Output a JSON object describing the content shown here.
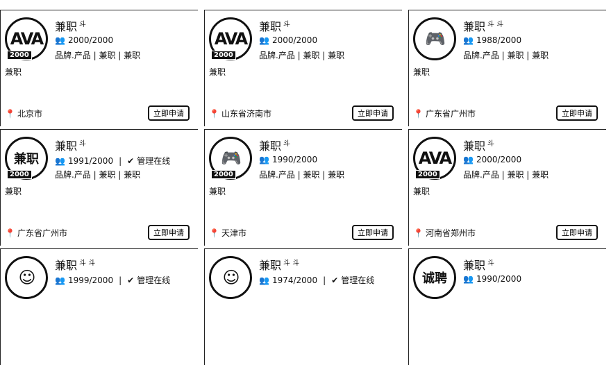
{
  "cards": [
    {
      "title": "兼职",
      "superscript": "斗",
      "logo_text": "AVA",
      "badge": "2000",
      "members": "2000/2000",
      "online": "",
      "tags": "品牌.产品 | 兼职 | 兼职",
      "desc": "兼职",
      "location": "北京市",
      "apply": "立即申请"
    },
    {
      "title": "兼职",
      "superscript": "斗",
      "logo_text": "AVA",
      "badge": "2000",
      "members": "2000/2000",
      "online": "",
      "tags": "品牌.产品 | 兼职 | 兼职",
      "desc": "兼职",
      "location": "山东省济南市",
      "apply": "立即申请"
    },
    {
      "title": "兼职",
      "superscript": "斗 斗",
      "logo_text": "🎮",
      "badge": "",
      "members": "1988/2000",
      "online": "",
      "tags": "品牌.产品 | 兼职 | 兼职",
      "desc": "兼职",
      "location": "广东省广州市",
      "apply": "立即申请"
    },
    {
      "title": "兼职",
      "superscript": "斗",
      "logo_text": "兼职",
      "badge": "2000",
      "members": "1991/2000",
      "online": "管理在线",
      "tags": "品牌.产品 | 兼职 | 兼职",
      "desc": "兼职",
      "location": "广东省广州市",
      "apply": "立即申请"
    },
    {
      "title": "兼职",
      "superscript": "斗",
      "logo_text": "🎮",
      "badge": "2000",
      "members": "1990/2000",
      "online": "",
      "tags": "品牌.产品 | 兼职 | 兼职",
      "desc": "兼职",
      "location": "天津市",
      "apply": "立即申请"
    },
    {
      "title": "兼职",
      "superscript": "斗",
      "logo_text": "AVA",
      "badge": "2000",
      "members": "2000/2000",
      "online": "",
      "tags": "品牌.产品 | 兼职 | 兼职",
      "desc": "兼职",
      "location": "河南省郑州市",
      "apply": "立即申请"
    },
    {
      "title": "兼职",
      "superscript": "斗 斗",
      "logo_text": "☺",
      "badge": "",
      "members": "1999/2000",
      "online": "管理在线",
      "tags": "",
      "desc": "",
      "location": "",
      "apply": ""
    },
    {
      "title": "兼职",
      "superscript": "斗 斗",
      "logo_text": "☺",
      "badge": "",
      "members": "1974/2000",
      "online": "管理在线",
      "tags": "",
      "desc": "",
      "location": "",
      "apply": ""
    },
    {
      "title": "兼职",
      "superscript": "斗",
      "logo_text": "诚聘",
      "badge": "",
      "members": "1990/2000",
      "online": "",
      "tags": "",
      "desc": "",
      "location": "",
      "apply": ""
    }
  ]
}
